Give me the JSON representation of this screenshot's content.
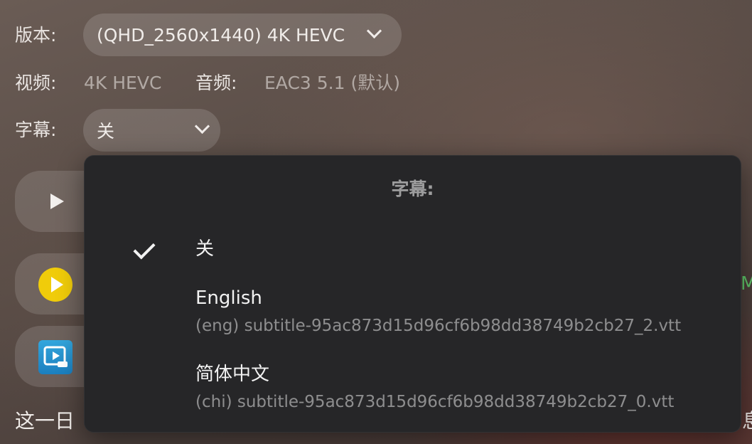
{
  "version_row": {
    "label": "版本:",
    "selected": "(QHD_2560x1440) 4K HEVC"
  },
  "info_row": {
    "video_label": "视频:",
    "video_value": "4K HEVC",
    "audio_label": "音频:",
    "audio_value": "EAC3 5.1 (默认)"
  },
  "subtitle_row": {
    "label": "字幕:",
    "selected": "关"
  },
  "background": {
    "description_fragment_left": "这一日",
    "description_fragment_right": "息",
    "green_fragment": "M"
  },
  "subtitle_menu": {
    "title": "字幕:",
    "options": [
      {
        "label": "关",
        "sublabel": "",
        "selected": true
      },
      {
        "label": "English",
        "sublabel": "(eng) subtitle-95ac873d15d96cf6b98dd38749b2cb27_2.vtt",
        "selected": false
      },
      {
        "label": "简体中文",
        "sublabel": "(chi) subtitle-95ac873d15d96cf6b98dd38749b2cb27_0.vtt",
        "selected": false
      }
    ]
  },
  "colors": {
    "menu_bg": "#262628",
    "accent_yellow": "#f0cc0a",
    "app_icon_blue": "#1b7fbf",
    "green_text": "#5fc86a"
  },
  "icons": [
    "chevron-down-icon",
    "play-icon",
    "yellow-play-icon",
    "app-icon",
    "checkmark-icon"
  ]
}
